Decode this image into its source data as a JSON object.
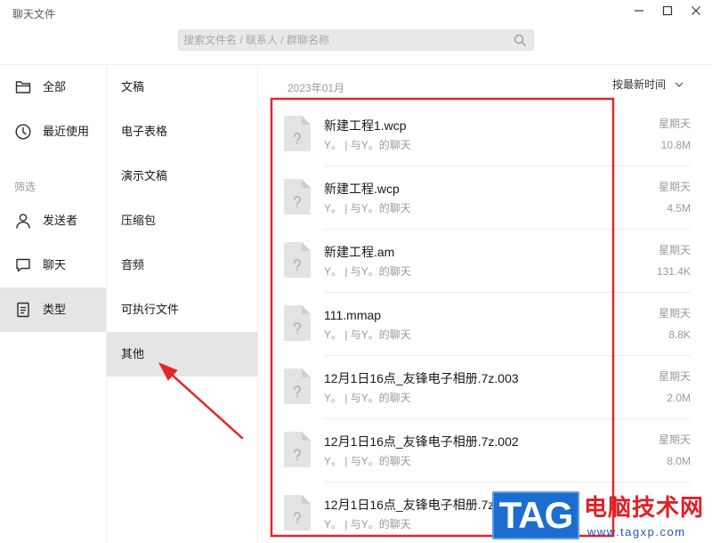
{
  "window": {
    "title": "聊天文件",
    "controls": [
      "minimize-icon",
      "maximize-icon",
      "close-icon"
    ]
  },
  "search": {
    "placeholder": "搜索文件名 / 联系人 / 群聊名称",
    "icon": "search-icon"
  },
  "sidebar": {
    "items": [
      {
        "label": "全部",
        "icon": "folder-icon",
        "selected": false
      },
      {
        "label": "最近使用",
        "icon": "clock-icon",
        "selected": false
      }
    ],
    "filter_heading": "筛选",
    "filters": [
      {
        "label": "发送者",
        "icon": "person-icon",
        "selected": false
      },
      {
        "label": "聊天",
        "icon": "chat-bubble-icon",
        "selected": false
      },
      {
        "label": "类型",
        "icon": "document-icon",
        "selected": true
      }
    ]
  },
  "types": [
    {
      "label": "文稿",
      "selected": false
    },
    {
      "label": "电子表格",
      "selected": false
    },
    {
      "label": "演示文稿",
      "selected": false
    },
    {
      "label": "压缩包",
      "selected": false
    },
    {
      "label": "音频",
      "selected": false
    },
    {
      "label": "可执行文件",
      "selected": false
    },
    {
      "label": "其他",
      "selected": true
    }
  ],
  "main": {
    "month": "2023年01月",
    "sort_label": "按最新时间",
    "sort_icon": "chevron-down-icon",
    "files": [
      {
        "name": "新建工程1.wcp",
        "source": "Y。 | 与Y。的聊天",
        "day": "星期天",
        "size": "10.8M",
        "icon": "unknown-file-icon"
      },
      {
        "name": "新建工程.wcp",
        "source": "Y。 | 与Y。的聊天",
        "day": "星期天",
        "size": "4.5M",
        "icon": "unknown-file-icon"
      },
      {
        "name": "新建工程.am",
        "source": "Y。 | 与Y。的聊天",
        "day": "星期天",
        "size": "131.4K",
        "icon": "unknown-file-icon"
      },
      {
        "name": "111.mmap",
        "source": "Y。 | 与Y。的聊天",
        "day": "星期天",
        "size": "8.8K",
        "icon": "unknown-file-icon"
      },
      {
        "name": "12月1日16点_友锋电子相册.7z.003",
        "source": "Y。 | 与Y。的聊天",
        "day": "星期天",
        "size": "2.0M",
        "icon": "unknown-file-icon"
      },
      {
        "name": "12月1日16点_友锋电子相册.7z.002",
        "source": "Y。 | 与Y。的聊天",
        "day": "星期天",
        "size": "8.0M",
        "icon": "unknown-file-icon"
      },
      {
        "name": "12月1日16点_友锋电子相册.7z",
        "source": "Y。 | 与Y。的聊天",
        "icon": "unknown-file-icon"
      }
    ]
  },
  "watermark": {
    "logo_text": "TAG",
    "site_name": "电脑技术网",
    "url": "www.tagxp.com"
  },
  "colors": {
    "annotation": "#e3262b",
    "selected_background": "#e5e5e5",
    "watermark_logo": "#1c6dd0",
    "watermark_name": "#e01f26",
    "watermark_url": "#1f58b5"
  }
}
